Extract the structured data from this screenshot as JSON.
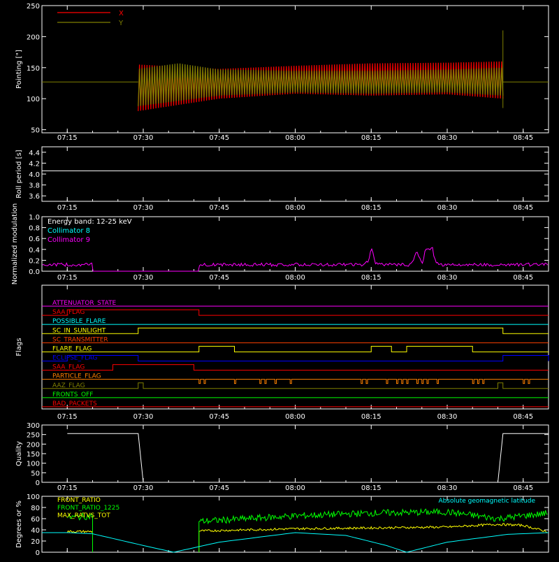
{
  "x_ticks": [
    "07:15",
    "07:30",
    "07:45",
    "08:00",
    "08:15",
    "08:30",
    "08:45"
  ],
  "chart_data": [
    {
      "type": "line",
      "title": "",
      "ylabel": "Pointing [\"]",
      "ylim": [
        45,
        250
      ],
      "yticks": [
        50,
        100,
        150,
        200,
        250
      ],
      "legend": [
        {
          "name": "X",
          "color": "#ff0000"
        },
        {
          "name": "Y",
          "color": "#808000"
        }
      ],
      "series": [
        {
          "name": "X",
          "color": "#ff0000",
          "baseline": 127,
          "active_from": "07:29",
          "active_to": "08:41",
          "envelope_low": [
            [
              "07:29",
              80
            ],
            [
              "07:45",
              100
            ],
            [
              "08:00",
              108
            ],
            [
              "08:15",
              105
            ],
            [
              "08:30",
              107
            ],
            [
              "08:41",
              100
            ]
          ],
          "envelope_high": [
            [
              "07:29",
              155
            ],
            [
              "07:45",
              148
            ],
            [
              "08:00",
              153
            ],
            [
              "08:15",
              157
            ],
            [
              "08:30",
              158
            ],
            [
              "08:41",
              160
            ]
          ]
        },
        {
          "name": "Y",
          "color": "#808000",
          "baseline": 127,
          "active_from": "07:29",
          "active_to": "08:41",
          "envelope_low": [
            [
              "07:29",
              88
            ],
            [
              "07:45",
              105
            ],
            [
              "08:00",
              110
            ],
            [
              "08:15",
              108
            ],
            [
              "08:30",
              110
            ],
            [
              "08:41",
              105
            ]
          ],
          "envelope_high": [
            [
              "07:29",
              148
            ],
            [
              "07:37",
              157
            ],
            [
              "07:45",
              147
            ],
            [
              "08:00",
              145
            ],
            [
              "08:15",
              145
            ],
            [
              "08:30",
              147
            ],
            [
              "08:41",
              150
            ]
          ]
        }
      ]
    },
    {
      "type": "line",
      "ylabel": "Roll period [s]",
      "ylim": [
        3.5,
        4.5
      ],
      "yticks": [
        3.6,
        3.8,
        4.0,
        4.2,
        4.4
      ],
      "series": [
        {
          "name": "",
          "color": "#ffffff",
          "constant": 4.06
        }
      ]
    },
    {
      "type": "line",
      "ylabel": "Normalized modulation",
      "ylim": [
        0,
        1.0
      ],
      "yticks": [
        0,
        0.2,
        0.4,
        0.6,
        0.8,
        1.0
      ],
      "legend_title": "Energy band: 12-25 keV",
      "legend": [
        {
          "name": "Collimator 8",
          "color": "#00ffff"
        },
        {
          "name": "Collimator 9",
          "color": "#ff00ff"
        }
      ],
      "series": [
        {
          "name": "Collimator 9",
          "color": "#ff00ff",
          "base": 0.12,
          "gaps": [
            [
              "07:20",
              "07:41"
            ]
          ],
          "peaks": [
            [
              "08:15",
              0.3
            ],
            [
              "08:24",
              0.3
            ],
            [
              "08:26",
              0.35
            ],
            [
              "08:27",
              0.33
            ]
          ]
        }
      ]
    },
    {
      "type": "line",
      "ylabel": "Flags",
      "flags": [
        {
          "name": "ATTENUATOR_STATE",
          "color": "#ff00ff",
          "high": []
        },
        {
          "name": "SAA_FLAG_TOP",
          "label": "SAA_FLAG",
          "color": "#ff0000",
          "high": [
            [
              "07:15",
              "07:41"
            ]
          ]
        },
        {
          "name": "POSSIBLE_FLARE",
          "color": "#00ffff",
          "high": []
        },
        {
          "name": "SC_IN_SUNLIGHT",
          "color": "#ffff00",
          "high": [
            [
              "07:29",
              "08:41"
            ]
          ]
        },
        {
          "name": "SC_TRANSMITTER",
          "color": "#ff4000",
          "high": []
        },
        {
          "name": "FLARE_FLAG",
          "color": "#ffff00",
          "high": [
            [
              "07:41",
              "07:48"
            ],
            [
              "08:15",
              "08:19"
            ],
            [
              "08:22",
              "08:35"
            ]
          ]
        },
        {
          "name": "ECLIPSE_FLAG",
          "color": "#0000ff",
          "high": [
            [
              "07:15",
              "07:29"
            ],
            [
              "08:41",
              "08:50"
            ]
          ]
        },
        {
          "name": "SAA_FLAG",
          "color": "#ff0000",
          "high": [
            [
              "07:24",
              "07:40"
            ]
          ]
        },
        {
          "name": "PARTICLE_FLAG",
          "color": "#ff8000",
          "spikes": [
            "07:41",
            "07:42",
            "07:48",
            "07:53",
            "07:54",
            "07:56",
            "07:59",
            "08:13",
            "08:14",
            "08:18",
            "08:20",
            "08:21",
            "08:22",
            "08:24",
            "08:25",
            "08:26",
            "08:28",
            "08:35",
            "08:36",
            "08:37",
            "08:45",
            "08:46"
          ]
        },
        {
          "name": "AAZ_FLAG",
          "color": "#808000",
          "high": [
            [
              "07:29",
              "07:30"
            ],
            [
              "08:40",
              "08:41"
            ]
          ]
        },
        {
          "name": "FRONTS_OFF",
          "color": "#00ff00",
          "high": []
        },
        {
          "name": "BAD_PACKETS",
          "color": "#ff0000",
          "high": []
        }
      ]
    },
    {
      "type": "line",
      "ylabel": "Quality",
      "ylim": [
        0,
        300
      ],
      "yticks": [
        0,
        50,
        100,
        150,
        200,
        250,
        300
      ],
      "series": [
        {
          "name": "",
          "color": "#ffffff",
          "points": [
            [
              "07:15",
              255
            ],
            [
              "07:29",
              255
            ],
            [
              "07:30",
              0
            ],
            [
              "08:40",
              0
            ],
            [
              "08:41",
              255
            ],
            [
              "08:50",
              255
            ]
          ]
        }
      ]
    },
    {
      "type": "line",
      "ylabel": "Degrees or %",
      "ylim": [
        0,
        100
      ],
      "yticks": [
        0,
        20,
        40,
        60,
        80,
        100
      ],
      "legend": [
        {
          "name": "FRONT_RATIO",
          "color": "#ffff00"
        },
        {
          "name": "FRONT_RATIO_1225",
          "color": "#00ff00"
        },
        {
          "name": "MAX_RATVS_TOT",
          "color": "#ffff00"
        }
      ],
      "legend_right": {
        "name": "Absolute geomagnetic latitude",
        "color": "#00ffff"
      },
      "series": [
        {
          "name": "FRONT_RATIO",
          "color": "#ffff00",
          "segments": [
            [
              [
                "07:15",
                37
              ],
              [
                "07:20",
                37
              ]
            ],
            [
              [
                "07:41",
                38
              ],
              [
                "08:00",
                42
              ],
              [
                "08:20",
                44
              ],
              [
                "08:30",
                45
              ],
              [
                "08:40",
                50
              ],
              [
                "08:45",
                48
              ],
              [
                "08:50",
                36
              ]
            ]
          ]
        },
        {
          "name": "FRONT_RATIO_1225",
          "color": "#00ff00",
          "segments": [
            [
              [
                "07:15",
                62
              ],
              [
                "07:20",
                65
              ]
            ],
            [
              [
                "07:41",
                55
              ],
              [
                "08:00",
                65
              ],
              [
                "08:15",
                70
              ],
              [
                "08:30",
                72
              ],
              [
                "08:40",
                60
              ],
              [
                "08:50",
                70
              ]
            ]
          ]
        },
        {
          "name": "Absolute geomagnetic latitude",
          "color": "#00ffff",
          "points": [
            [
              "07:15",
              35
            ],
            [
              "07:20",
              33
            ],
            [
              "07:30",
              12
            ],
            [
              "07:36",
              0
            ],
            [
              "07:45",
              18
            ],
            [
              "08:00",
              35
            ],
            [
              "08:10",
              30
            ],
            [
              "08:18",
              12
            ],
            [
              "08:22",
              0
            ],
            [
              "08:30",
              18
            ],
            [
              "08:42",
              32
            ],
            [
              "08:50",
              35
            ]
          ]
        }
      ]
    }
  ]
}
